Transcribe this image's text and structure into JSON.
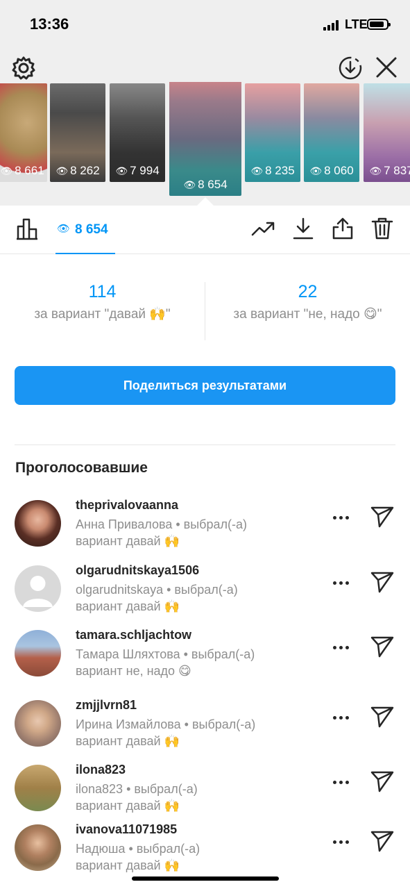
{
  "status_bar": {
    "time": "13:36",
    "network": "LTE"
  },
  "thumbnails": [
    {
      "views": "8 661"
    },
    {
      "views": "8 262"
    },
    {
      "views": "7 994"
    },
    {
      "views": "8 654"
    },
    {
      "views": "8 235"
    },
    {
      "views": "8 060"
    },
    {
      "views": "7 837"
    }
  ],
  "toolbar": {
    "views": "8 654"
  },
  "results": {
    "left": {
      "count": "114",
      "label": "за вариант \"давай 🙌\""
    },
    "right": {
      "count": "22",
      "label": "за вариант \"не, надо 😋\""
    }
  },
  "share_button": "Поделиться результатами",
  "voters_title": "Проголосовавшие",
  "voters": [
    {
      "username": "theprivalovaanna",
      "line1": "Анна Привалова • выбрал(-а)",
      "line2": "вариант давай 🙌"
    },
    {
      "username": "olgarudnitskaya1506",
      "line1": "olgarudnitskaya • выбрал(-а)",
      "line2": "вариант давай 🙌"
    },
    {
      "username": "tamara.schljachtow",
      "line1": "Тамара Шляхтова • выбрал(-а)",
      "line2": "вариант не, надо 😋"
    },
    {
      "username": "zmjjlvrn81",
      "line1": "Ирина Измайлова • выбрал(-а)",
      "line2": "вариант давай 🙌"
    },
    {
      "username": "ilona823",
      "line1": "ilona823 • выбрал(-а)",
      "line2": "вариант давай 🙌"
    },
    {
      "username": "ivanova11071985",
      "line1": "Надюша • выбрал(-а)",
      "line2": "вариант давай 🙌"
    }
  ]
}
